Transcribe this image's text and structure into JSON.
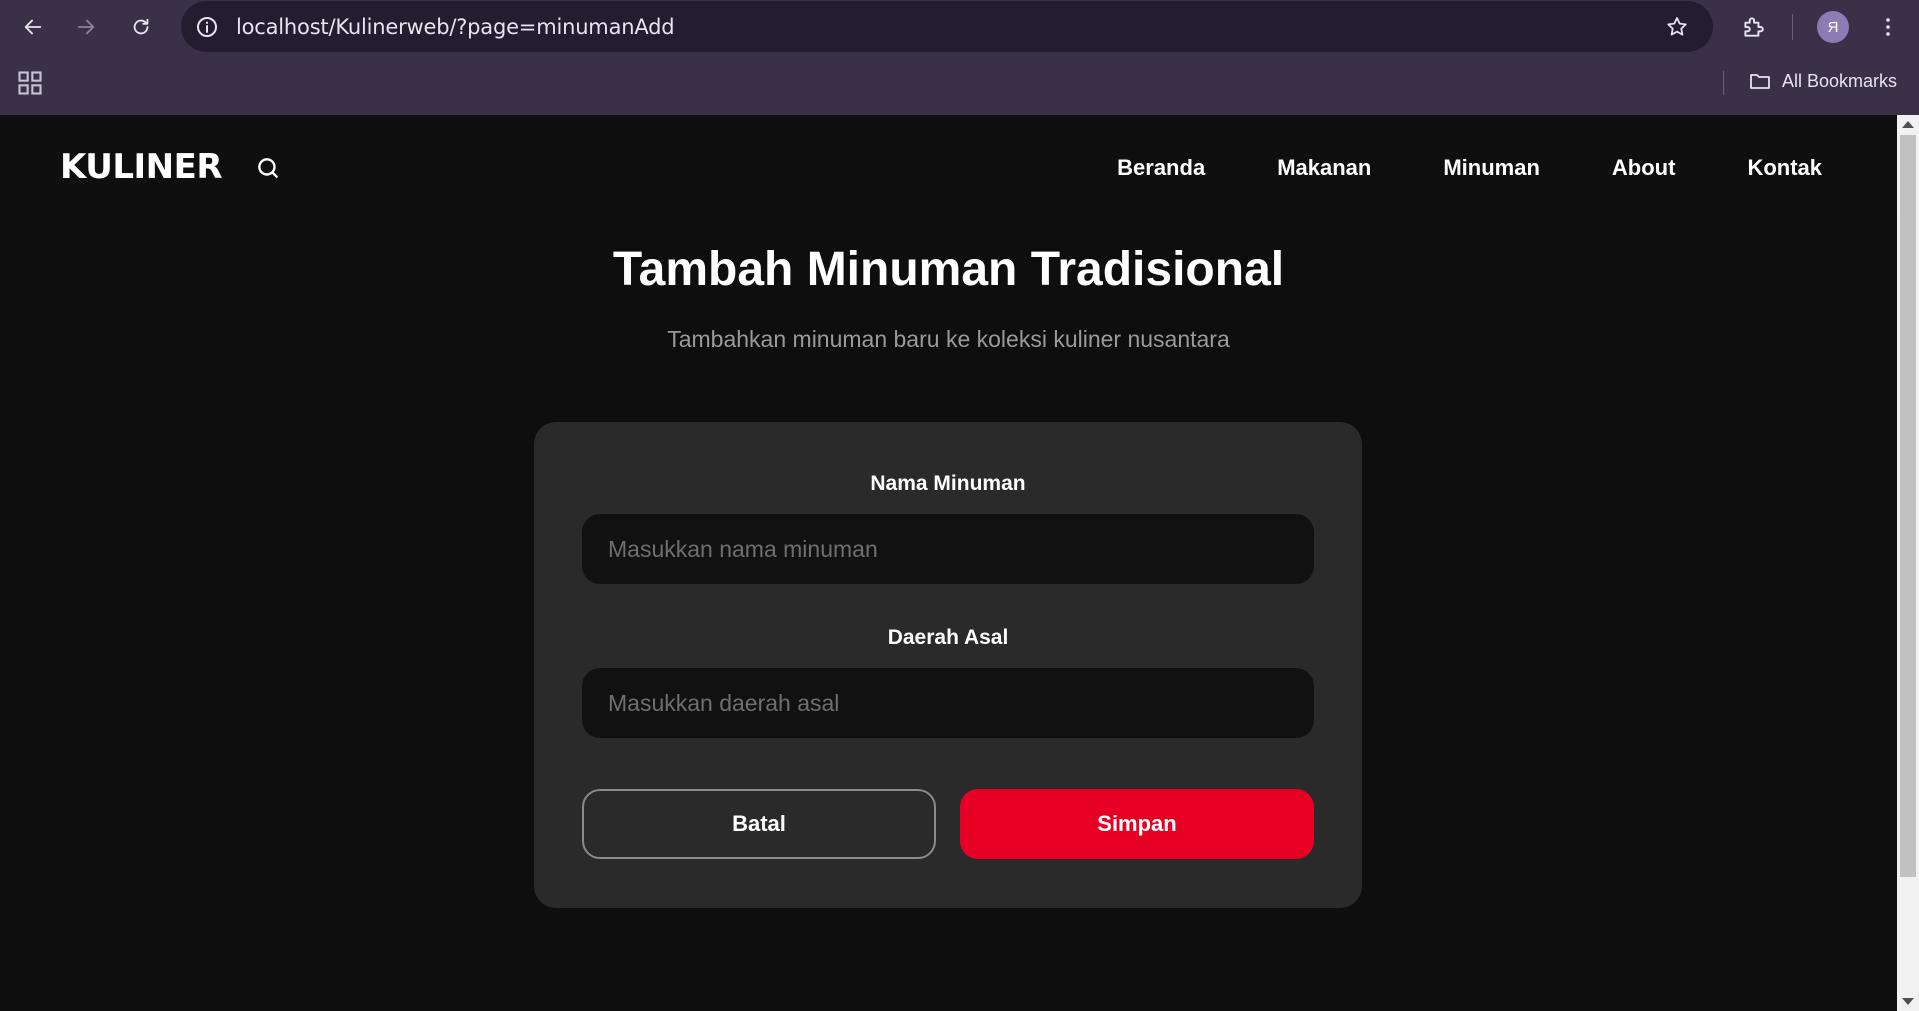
{
  "browser": {
    "url": "localhost/Kulinerweb/?page=minumanAdd",
    "bookmarks_label": "All Bookmarks",
    "profile_initial": "Я"
  },
  "site": {
    "logo": "KULINER",
    "nav": [
      "Beranda",
      "Makanan",
      "Minuman",
      "About",
      "Kontak"
    ]
  },
  "main": {
    "title": "Tambah Minuman Tradisional",
    "subtitle": "Tambahkan minuman baru ke koleksi kuliner nusantara"
  },
  "form": {
    "name_label": "Nama Minuman",
    "name_placeholder": "Masukkan nama minuman",
    "origin_label": "Daerah Asal",
    "origin_placeholder": "Masukkan daerah asal",
    "cancel_label": "Batal",
    "save_label": "Simpan"
  },
  "colors": {
    "accent": "#e60023",
    "background": "#0e0e0e",
    "card": "#2a2a2a",
    "browser_chrome": "#3a3148"
  }
}
